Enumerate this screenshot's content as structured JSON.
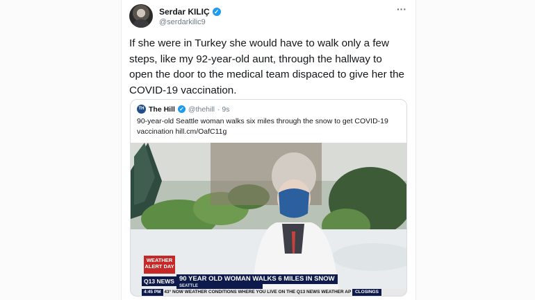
{
  "tweet": {
    "author_name": "Serdar KILIÇ",
    "handle": "@serdarkilic9",
    "text": "If she were in Turkey she would have to walk only a few steps, like my 92-year-old aunt, through the hallway to open the door to the medical team dispaced to give her the COVID-19 vaccination.",
    "more_icon": "···",
    "verified_icon": "✓"
  },
  "quote": {
    "logo_text": "TH",
    "author_name": "The Hill",
    "handle": "@thehill",
    "age": "· 9s",
    "text": "90-year-old Seattle woman walks six miles through the snow to get COVID-19 vaccination hill.cm/OafC11g"
  },
  "broadcast": {
    "alert": "WEATHER ALERT DAY",
    "station": "Q13 NEWS",
    "headline": "90 YEAR OLD WOMAN WALKS 6 MILES IN SNOW",
    "location": "SEATTLE",
    "time": "4:45 PM",
    "temp": "43°",
    "ticker": "NOW WEATHER CONDITIONS WHERE YOU LIVE ON THE Q13 NEWS WEATHER AP",
    "closings": "CLOSINGS"
  },
  "colors": {
    "verified": "#1d9bf0",
    "news_blue": "#0d1a4b",
    "alert_red": "#c62828"
  }
}
